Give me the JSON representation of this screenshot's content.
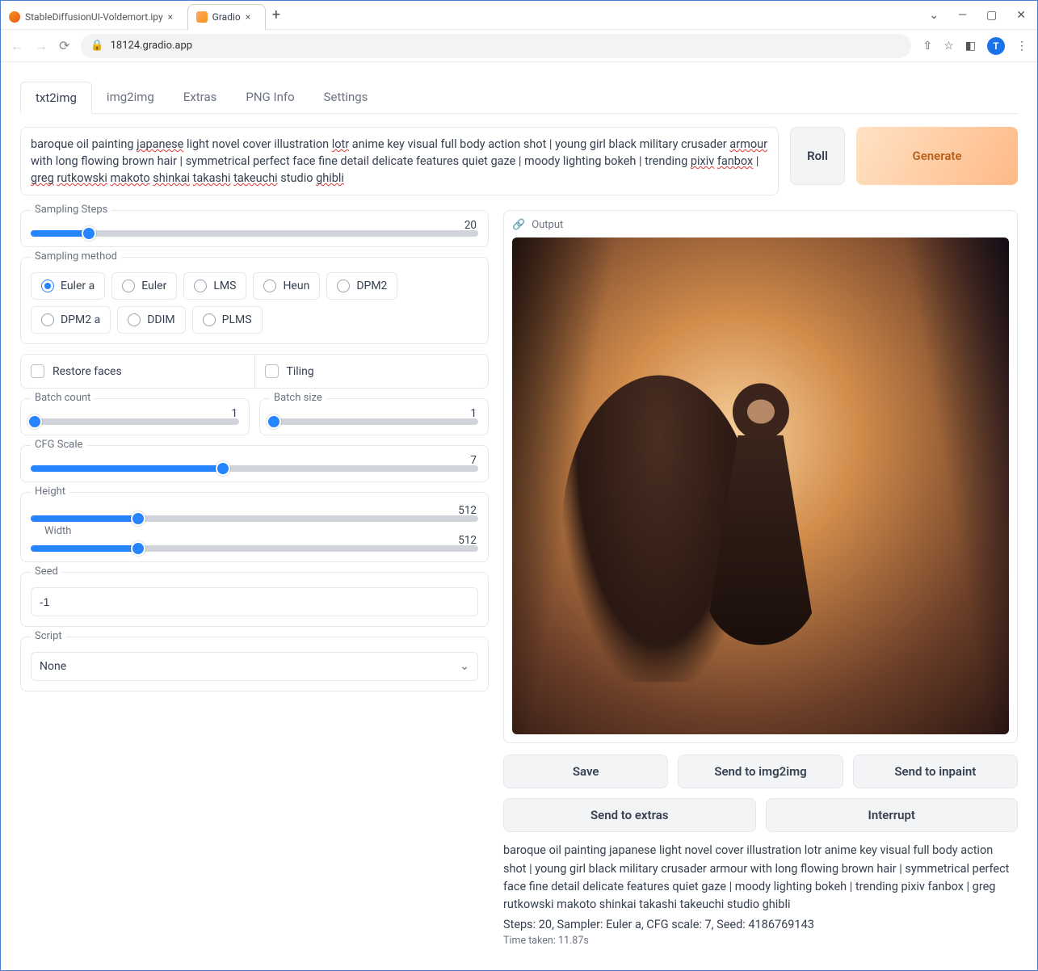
{
  "browser": {
    "tabs": [
      {
        "label": "StableDiffusionUI-Voldemort.ipy",
        "active": false,
        "favicon": "#f7931e"
      },
      {
        "label": "Gradio",
        "active": true,
        "favicon": "#f7931e"
      }
    ],
    "url": "18124.gradio.app",
    "avatar_letter": "T"
  },
  "tabs": [
    "txt2img",
    "img2img",
    "Extras",
    "PNG Info",
    "Settings"
  ],
  "active_tab": "txt2img",
  "prompt": "baroque oil painting japanese light novel cover illustration lotr anime key visual full body action shot | young girl black military crusader armour with long flowing brown hair | symmetrical perfect face fine detail delicate features quiet gaze | moody lighting bokeh | trending pixiv fanbox | greg rutkowski makoto shinkai takashi takeuchi studio ghibli",
  "prompt_redline_words": [
    "japanese",
    "lotr",
    "armour",
    "pixiv",
    "fanbox",
    "greg",
    "rutkowski",
    "makoto",
    "shinkai",
    "takashi",
    "takeuchi",
    "ghibli"
  ],
  "buttons": {
    "roll": "Roll",
    "generate": "Generate"
  },
  "sampling_steps": {
    "label": "Sampling Steps",
    "value": 20,
    "max": 150,
    "pct": 13
  },
  "sampling_method": {
    "label": "Sampling method",
    "options": [
      "Euler a",
      "Euler",
      "LMS",
      "Heun",
      "DPM2",
      "DPM2 a",
      "DDIM",
      "PLMS"
    ],
    "selected": "Euler a"
  },
  "restore_faces": {
    "label": "Restore faces",
    "checked": false
  },
  "tiling": {
    "label": "Tiling",
    "checked": false
  },
  "batch_count": {
    "label": "Batch count",
    "value": 1,
    "pct": 2
  },
  "batch_size": {
    "label": "Batch size",
    "value": 1,
    "pct": 2
  },
  "cfg_scale": {
    "label": "CFG Scale",
    "value": 7,
    "pct": 43
  },
  "height": {
    "label": "Height",
    "value": 512,
    "pct": 24
  },
  "width": {
    "label": "Width",
    "value": 512,
    "pct": 24
  },
  "seed": {
    "label": "Seed",
    "value": "-1"
  },
  "script": {
    "label": "Script",
    "value": "None"
  },
  "output": {
    "label": "Output",
    "actions": {
      "save": "Save",
      "send_img2img": "Send to img2img",
      "send_inpaint": "Send to inpaint",
      "send_extras": "Send to extras",
      "interrupt": "Interrupt"
    },
    "result_prompt": "baroque oil painting japanese light novel cover illustration lotr anime key visual full body action shot | young girl black military crusader armour with long flowing brown hair | symmetrical perfect face fine detail delicate features quiet gaze | moody lighting bokeh | trending pixiv fanbox | greg rutkowski makoto shinkai takashi takeuchi studio ghibli",
    "result_meta": "Steps: 20, Sampler: Euler a, CFG scale: 7, Seed: 4186769143",
    "time_taken": "Time taken: 11.87s"
  }
}
